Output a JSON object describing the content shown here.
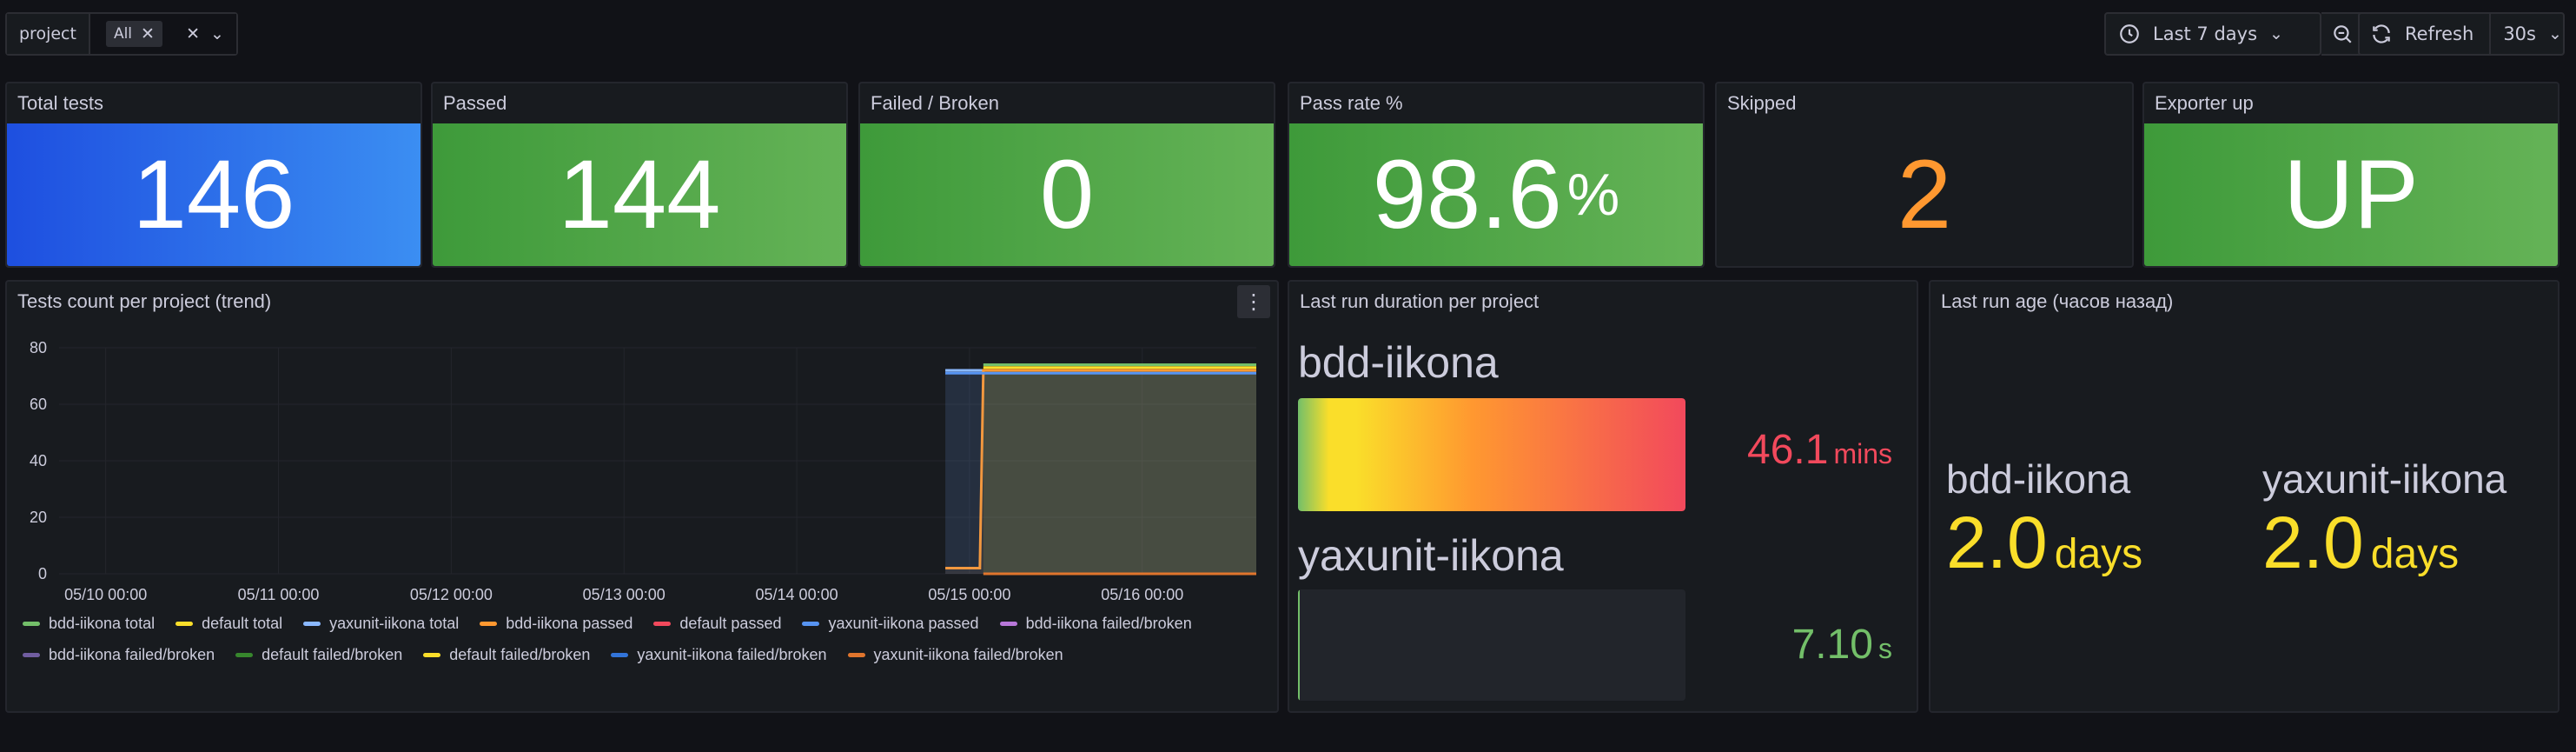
{
  "variables": {
    "label": "project",
    "selected": "All"
  },
  "toolbar": {
    "time_range": "Last 7 days",
    "refresh_label": "Refresh",
    "refresh_interval": "30s"
  },
  "stats": [
    {
      "title": "Total tests",
      "value": "146",
      "unit": "",
      "color": "#3274d9"
    },
    {
      "title": "Passed",
      "value": "144",
      "unit": "",
      "color": "#56a64b"
    },
    {
      "title": "Failed / Broken",
      "value": "0",
      "unit": "",
      "color": "#56a64b"
    },
    {
      "title": "Pass rate %",
      "value": "98.6",
      "unit": "%",
      "color": "#56a64b"
    },
    {
      "title": "Skipped",
      "value": "2",
      "unit": "",
      "color": "#ff9830"
    },
    {
      "title": "Exporter up",
      "value": "UP",
      "unit": "",
      "color": "#56a64b"
    }
  ],
  "trend_panel": {
    "title": "Tests count per project (trend)",
    "legend": [
      {
        "name": "bdd-iikona total",
        "color": "#73bf69"
      },
      {
        "name": "default total",
        "color": "#fade2a"
      },
      {
        "name": "yaxunit-iikona total",
        "color": "#8ab8ff"
      },
      {
        "name": "bdd-iikona passed",
        "color": "#ff9830"
      },
      {
        "name": "default passed",
        "color": "#f2495c"
      },
      {
        "name": "yaxunit-iikona passed",
        "color": "#5794f2"
      },
      {
        "name": "bdd-iikona failed/broken",
        "color": "#b877d9"
      },
      {
        "name": "bdd-iikona failed/broken",
        "color": "#705da0"
      },
      {
        "name": "default failed/broken",
        "color": "#37872d"
      },
      {
        "name": "default failed/broken",
        "color": "#fade2a"
      },
      {
        "name": "yaxunit-iikona failed/broken",
        "color": "#3274d9"
      },
      {
        "name": "yaxunit-iikona failed/broken",
        "color": "#e0752d"
      }
    ]
  },
  "chart_data": {
    "type": "line",
    "title": "Tests count per project (trend)",
    "x_ticks": [
      "05/10 00:00",
      "05/11 00:00",
      "05/12 00:00",
      "05/13 00:00",
      "05/14 00:00",
      "05/15 00:00",
      "05/16 00:00"
    ],
    "ylim": [
      0,
      80
    ],
    "y_ticks": [
      0,
      20,
      40,
      60,
      80
    ],
    "xlim_days": [
      -0.27,
      6.66
    ],
    "grid": true,
    "legend_position": "bottom",
    "series": [
      {
        "name": "yaxunit-iikona total",
        "color": "#8ab8ff",
        "points": [
          [
            4.86,
            72
          ],
          [
            6.66,
            72
          ]
        ]
      },
      {
        "name": "bdd-iikona total",
        "color": "#73bf69",
        "points": [
          [
            5.08,
            74
          ],
          [
            6.66,
            74
          ]
        ]
      },
      {
        "name": "default total",
        "color": "#fade2a",
        "points": [
          [
            5.08,
            73
          ],
          [
            6.66,
            73
          ]
        ]
      },
      {
        "name": "bdd-iikona passed",
        "color": "#ff9830",
        "points": [
          [
            4.86,
            2
          ],
          [
            5.06,
            2
          ],
          [
            5.08,
            72
          ],
          [
            6.66,
            72
          ]
        ]
      },
      {
        "name": "yaxunit-iikona passed",
        "color": "#5794f2",
        "points": [
          [
            4.86,
            71
          ],
          [
            6.66,
            71
          ]
        ]
      },
      {
        "name": "bdd-iikona failed/broken",
        "color": "#e0752d",
        "points": [
          [
            5.08,
            0
          ],
          [
            6.66,
            0
          ]
        ]
      }
    ]
  },
  "duration_panel": {
    "title": "Last run duration per project",
    "items": [
      {
        "name": "bdd-iikona",
        "value": "46.1",
        "unit": "mins",
        "fraction": 1.0,
        "color": "#f2495c"
      },
      {
        "name": "yaxunit-iikona",
        "value": "7.10",
        "unit": "s",
        "fraction": 0.005,
        "color": "#73bf69"
      }
    ]
  },
  "age_panel": {
    "title": "Last run age (часов назад)",
    "items": [
      {
        "name": "bdd-iikona",
        "value": "2.0",
        "unit": "days",
        "color": "#fade2a"
      },
      {
        "name": "yaxunit-iikona",
        "value": "2.0",
        "unit": "days",
        "color": "#fade2a"
      }
    ]
  }
}
